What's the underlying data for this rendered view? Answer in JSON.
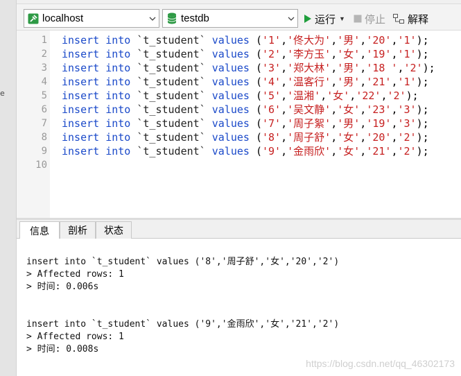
{
  "toolbar": {
    "connection": "localhost",
    "database": "testdb",
    "run_label": "运行",
    "stop_label": "停止",
    "explain_label": "解释"
  },
  "editor": {
    "line_numbers": [
      "1",
      "2",
      "3",
      "4",
      "5",
      "6",
      "7",
      "8",
      "9",
      "10"
    ],
    "lines": [
      {
        "kw1": "insert",
        "kw2": "into",
        "table": "`t_student`",
        "kw3": "values",
        "vals": [
          "'1'",
          "'佟大为'",
          "'男'",
          "'20'",
          "'1'"
        ]
      },
      {
        "kw1": "insert",
        "kw2": "into",
        "table": "`t_student`",
        "kw3": "values",
        "vals": [
          "'2'",
          "'李方玉'",
          "'女'",
          "'19'",
          "'1'"
        ]
      },
      {
        "kw1": "insert",
        "kw2": "into",
        "table": "`t_student`",
        "kw3": "values",
        "vals": [
          "'3'",
          "'郑大林'",
          "'男'",
          "'18 '",
          "'2'"
        ]
      },
      {
        "kw1": "insert",
        "kw2": "into",
        "table": "`t_student`",
        "kw3": "values",
        "vals": [
          "'4'",
          "'温客行'",
          "'男'",
          "'21'",
          "'1'"
        ]
      },
      {
        "kw1": "insert",
        "kw2": "into",
        "table": "`t_student`",
        "kw3": "values",
        "vals": [
          "'5'",
          "'温湘'",
          "'女'",
          "'22'",
          "'2'"
        ]
      },
      {
        "kw1": "insert",
        "kw2": "into",
        "table": "`t_student`",
        "kw3": "values",
        "vals": [
          "'6'",
          "'吴文静'",
          "'女'",
          "'23'",
          "'3'"
        ]
      },
      {
        "kw1": "insert",
        "kw2": "into",
        "table": "`t_student`",
        "kw3": "values",
        "vals": [
          "'7'",
          "'周子絮'",
          "'男'",
          "'19'",
          "'3'"
        ]
      },
      {
        "kw1": "insert",
        "kw2": "into",
        "table": "`t_student`",
        "kw3": "values",
        "vals": [
          "'8'",
          "'周子舒'",
          "'女'",
          "'20'",
          "'2'"
        ]
      },
      {
        "kw1": "insert",
        "kw2": "into",
        "table": "`t_student`",
        "kw3": "values",
        "vals": [
          "'9'",
          "'金雨欣'",
          "'女'",
          "'21'",
          "'2'"
        ]
      }
    ]
  },
  "tabs": {
    "info": "信息",
    "profile": "剖析",
    "status": "状态"
  },
  "output": {
    "lines": [
      "insert into `t_student` values ('8','周子舒','女','20','2')",
      "> Affected rows: 1",
      "> 时间: 0.006s",
      "insert into `t_student` values ('9','金雨欣','女','21','2')",
      "> Affected rows: 1",
      "> 时间: 0.008s"
    ]
  },
  "watermark": "https://blog.csdn.net/qq_46302173",
  "left_strip_mark": "e",
  "icons": {
    "connection": "connection-plug-icon",
    "database": "database-icon",
    "run": "play-icon",
    "stop": "stop-icon",
    "explain": "explain-icon"
  },
  "colors": {
    "keyword": "#1a49c9",
    "string": "#c61f1f",
    "run_green": "#1f9e3c",
    "db_green": "#1f9e3c"
  }
}
